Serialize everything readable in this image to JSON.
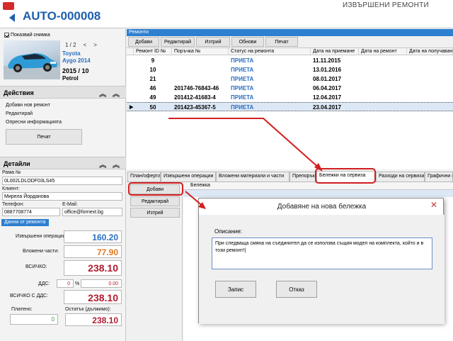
{
  "window": {
    "title": "ИЗВЪРШЕНИ РЕМОНТИ",
    "record_id": "AUTO-000008"
  },
  "vehicle": {
    "show_picture_label": "Показвай снимка",
    "pager": {
      "current": "1 / 2",
      "prev": "<",
      "next": ">"
    },
    "make": "Toyota",
    "model": "Aygo 2014",
    "year": "2015  / 10",
    "fuel": "Petrol"
  },
  "actions": {
    "title": "Действия",
    "items": [
      "Добави нов ремонт",
      "Редактирай",
      "Опресни информацията"
    ],
    "print_label": "Печат"
  },
  "details": {
    "title": "Детайли",
    "vin_label": "Рама №",
    "vin": "0L002LDLODF03LS45",
    "client_label": "Клиент:",
    "client": "Мирела Йорданова",
    "phone_label": "Телефон:",
    "phone": "0887708774",
    "email_label": "E-Mail:",
    "email": "office@fornext.bg",
    "repair_data_tab": "Данни от ремонта",
    "operations_label": "Извършени операции:",
    "operations_value": "160.20",
    "parts_label": "Вложени части:",
    "parts_value": "77.90",
    "total_label": "ВСИЧКО:",
    "total_value": "238.10",
    "vat_label": "ДДС:",
    "vat_percent": "0",
    "vat_percent_sign": "%",
    "vat_value": "0.00",
    "total_vat_label": "ВСИЧКО С ДДС:",
    "total_vat_value": "238.10",
    "paid_label": "Платено:",
    "paid_value": "0",
    "remaining_label": "Остатък (дължимо):",
    "remaining_value": "238.10",
    "colors": {
      "blue": "#2a6ec0",
      "orange": "#e07a1f",
      "red": "#b01c2e",
      "green": "#3a9a3a"
    }
  },
  "repairs": {
    "section_title": "Ремонти",
    "toolbar": [
      "Добави",
      "Редактирай",
      "Изтрий",
      "Обнови",
      "Печат"
    ],
    "columns": [
      "Ремонт ID №",
      "Поръчка №",
      "Статус на ремонта",
      "Дата на приемане",
      "Дата на ремонт",
      "Дата на получаване"
    ],
    "rows": [
      {
        "id": "9",
        "order": "",
        "status": "ПРИЕТА",
        "received": "11.11.2015",
        "selected": false
      },
      {
        "id": "10",
        "order": "",
        "status": "ПРИЕТА",
        "received": "13.01.2016",
        "selected": false
      },
      {
        "id": "21",
        "order": "",
        "status": "ПРИЕТА",
        "received": "08.01.2017",
        "selected": false
      },
      {
        "id": "46",
        "order": "201746-76843-46",
        "status": "ПРИЕТА",
        "received": "06.04.2017",
        "selected": false
      },
      {
        "id": "49",
        "order": "201412-41683-4",
        "status": "ПРИЕТА",
        "received": "12.04.2017",
        "selected": false
      },
      {
        "id": "50",
        "order": "201423-45367-5",
        "status": "ПРИЕТА",
        "received": "23.04.2017",
        "selected": true
      }
    ]
  },
  "tabs": [
    "План/оферта",
    "Извършени операции",
    "Вложени материали и части",
    "Препоръки",
    "Бележки на сервиза",
    "Разходи на сервиза",
    "Графични п"
  ],
  "active_tab": "Бележки на сервиза",
  "notes": {
    "buttons": [
      "Добави",
      "Редактирай",
      "Изтрий"
    ],
    "column": "Бележка"
  },
  "dialog": {
    "title": "Добавяне на нова бележка",
    "close_glyph": "✕",
    "field_label": "Описание:",
    "text": "При следваща смяна на съединител да се използва същия модел на комплекта, който и в този ремонт!|",
    "ok_label": "Запис",
    "cancel_label": "Отказ"
  }
}
